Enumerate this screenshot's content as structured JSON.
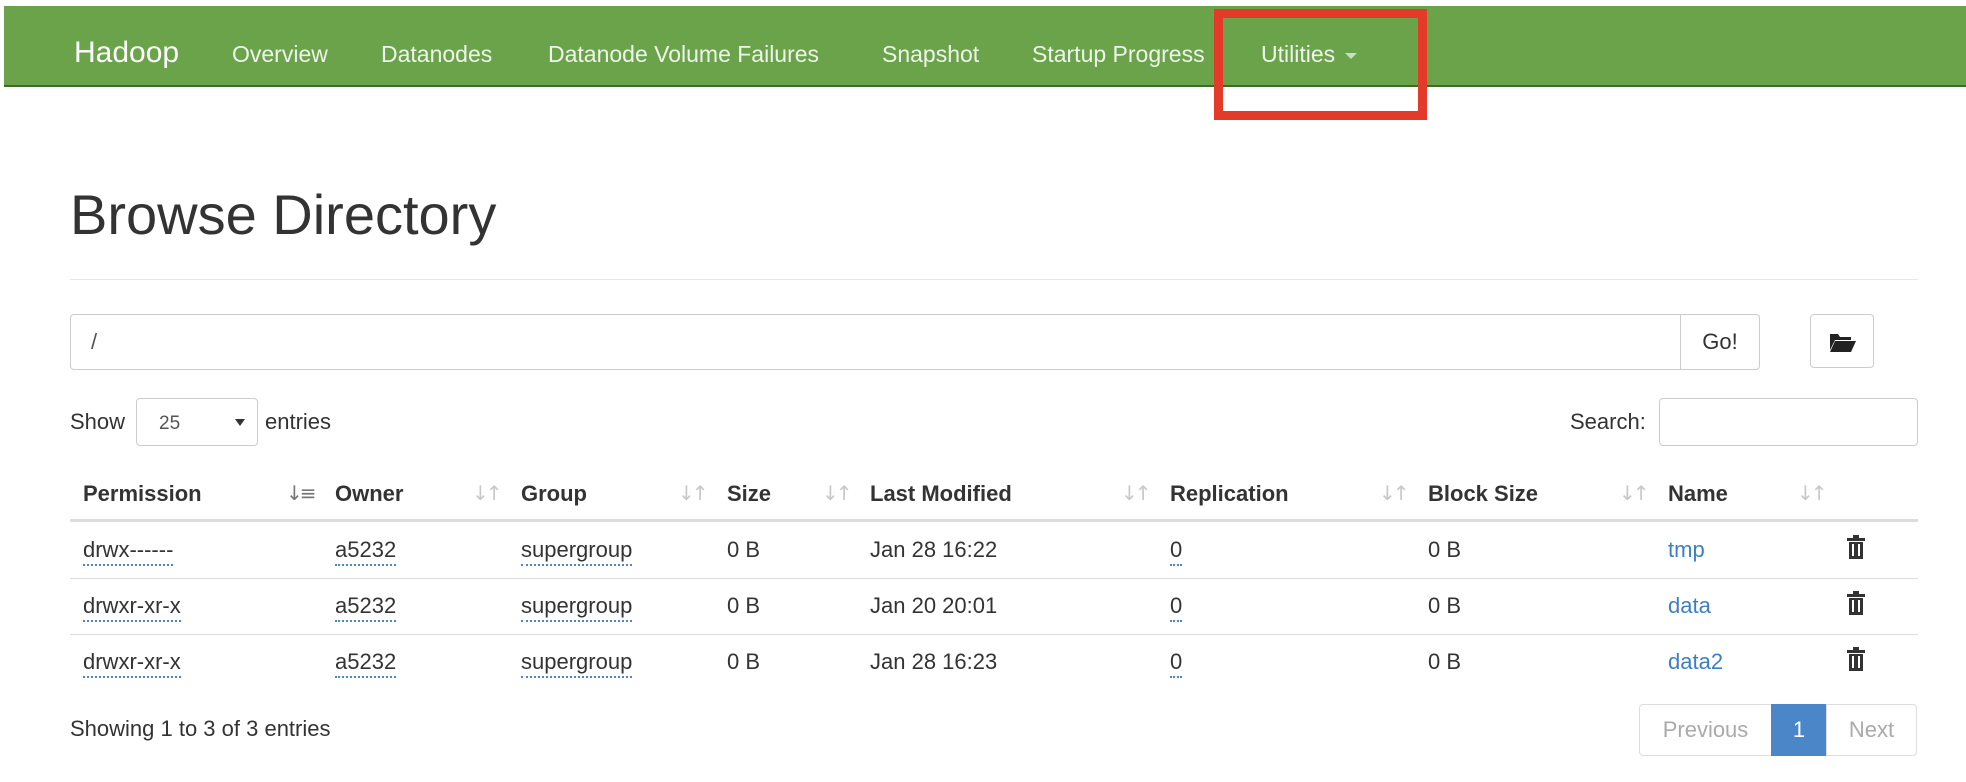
{
  "navbar": {
    "brand": "Hadoop",
    "items": [
      {
        "label": "Overview"
      },
      {
        "label": "Datanodes"
      },
      {
        "label": "Datanode Volume Failures"
      },
      {
        "label": "Snapshot"
      },
      {
        "label": "Startup Progress"
      },
      {
        "label": "Utilities"
      }
    ],
    "accent_color": "#6aa34a",
    "highlight_color": "#e43a2a"
  },
  "page": {
    "title": "Browse Directory"
  },
  "path_bar": {
    "value": "/",
    "go_label": "Go!",
    "folder_icon": "folder-open-icon"
  },
  "controls": {
    "show_label": "Show",
    "entries_value": "25",
    "entries_label": "entries",
    "search_label": "Search:"
  },
  "table": {
    "columns": [
      "Permission",
      "Owner",
      "Group",
      "Size",
      "Last Modified",
      "Replication",
      "Block Size",
      "Name"
    ],
    "sorted_column": "Permission",
    "rows": [
      {
        "permission": "drwx------",
        "owner": "a5232",
        "group": "supergroup",
        "size": "0 B",
        "last_modified": "Jan 28 16:22",
        "replication": "0",
        "block_size": "0 B",
        "name": "tmp"
      },
      {
        "permission": "drwxr-xr-x",
        "owner": "a5232",
        "group": "supergroup",
        "size": "0 B",
        "last_modified": "Jan 20 20:01",
        "replication": "0",
        "block_size": "0 B",
        "name": "data"
      },
      {
        "permission": "drwxr-xr-x",
        "owner": "a5232",
        "group": "supergroup",
        "size": "0 B",
        "last_modified": "Jan 28 16:23",
        "replication": "0",
        "block_size": "0 B",
        "name": "data2"
      }
    ],
    "row_action_icon": "trash-icon",
    "link_color": "#3d7fc0"
  },
  "footer": {
    "info": "Showing 1 to 3 of 3 entries",
    "previous_label": "Previous",
    "current_page": "1",
    "next_label": "Next"
  }
}
